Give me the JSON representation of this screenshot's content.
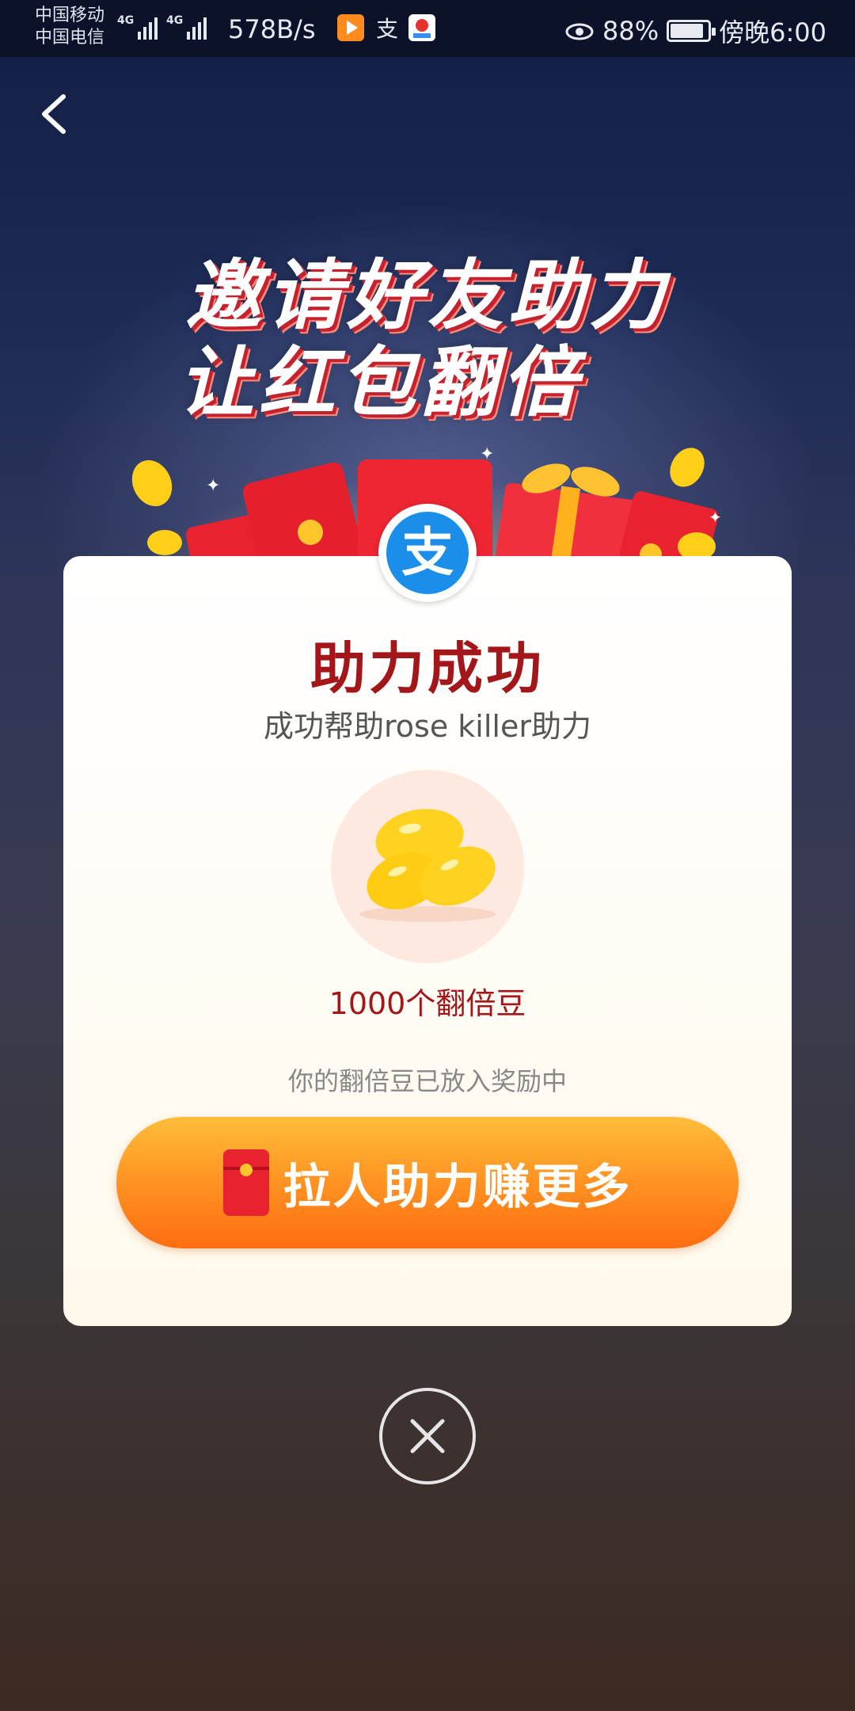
{
  "status_bar": {
    "carrier1": "中国移动",
    "carrier2": "中国电信",
    "network_tag1": "4G",
    "network_tag2": "4G",
    "net_speed": "578B/s",
    "battery_percent": "88%",
    "battery_level": 0.88,
    "time": "傍晚6:00",
    "icons": [
      "video-app-icon",
      "alipay-notification-icon",
      "baidu-map-icon",
      "eye-comfort-icon"
    ]
  },
  "headline": {
    "line1": "邀请好友助力",
    "line2": "让红包翻倍"
  },
  "card": {
    "logo_char": "支",
    "title": "助力成功",
    "subtitle": "成功帮助rose killer助力",
    "reward": "1000个翻倍豆",
    "note": "你的翻倍豆已放入奖励中",
    "cta_label": "拉人助力赚更多"
  },
  "colors": {
    "title_red": "#a3171b",
    "cta_orange": "#ff8a1e",
    "alipay_blue": "#1a8ee8",
    "bean_yellow": "#ffcf1a"
  }
}
